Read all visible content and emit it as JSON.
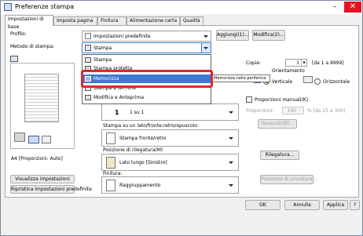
{
  "window": {
    "title": "Preferenze stampa"
  },
  "tabs": [
    {
      "label": "Impostazioni di base"
    },
    {
      "label": "Imposta pagina"
    },
    {
      "label": "Finitura"
    },
    {
      "label": "Alimentazione carta"
    },
    {
      "label": "Qualità"
    }
  ],
  "profile": {
    "label": "Profilo:",
    "value": "Impostazioni predefinite",
    "add_button": "Aggiungi(1)...",
    "edit_button": "Modifica(2)..."
  },
  "output_method": {
    "label": "Metodo di stampa:",
    "value": "Stampa",
    "options": [
      "Stampa",
      "Stampa protetta",
      "Memorizza",
      "Stampa a termine",
      "Modifica e Anteprima"
    ],
    "selected": "Memorizza",
    "tooltip": "Memorizza nella periferica."
  },
  "preview": {
    "caption": "A4 [Proporzioni: Auto]",
    "view_settings_button": "Visualizza impostazioni",
    "restore_defaults_button": "Ripristina impostazioni predefinite"
  },
  "copies": {
    "label": "Copie:",
    "value": "1",
    "range": "[da 1 a 9999]"
  },
  "orientation": {
    "label": "Orientamento",
    "portrait": "Verticale",
    "landscape": "Orizzontale",
    "selected": "Verticale"
  },
  "manual_scaling": {
    "label": "Proporzioni manuali(K)",
    "proportions_label": "Proporzioni:",
    "value": "100",
    "range": "% [da 25 a 300]"
  },
  "page_layout": {
    "value": "1 su 1"
  },
  "print_style": {
    "label": "Stampa su un lato/fronte-retro/opuscolo:",
    "value": "Stampa fronte/retro",
    "booklet_button": "Opuscolo(B)..."
  },
  "binding": {
    "label": "Posizione di rilegatura(M)",
    "value": "Lato lungo [Sinistro]",
    "button": "Rilegatura..."
  },
  "finishing": {
    "label": "Finitura:",
    "value": "Raggruppamento",
    "button": "Posizione di pinzatura..."
  },
  "footer": {
    "ok": "OK",
    "cancel": "Annulla",
    "apply": "Applica",
    "help": "?"
  },
  "icons": {
    "window": "printer-icon",
    "minimize": "minimize-icon",
    "close": "close-icon"
  }
}
